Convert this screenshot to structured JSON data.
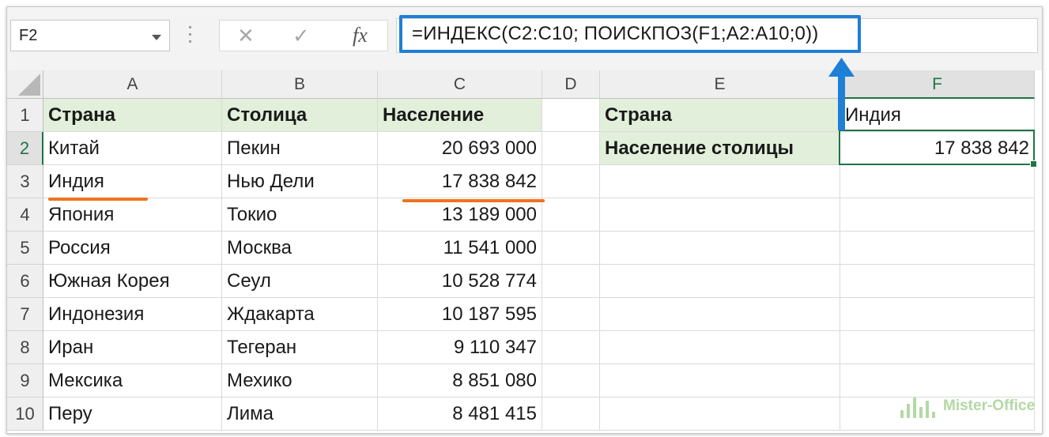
{
  "name_box": {
    "value": "F2"
  },
  "formula_bar": {
    "cancel_glyph": "✕",
    "enter_glyph": "✓",
    "fx_label": "fx",
    "formula": "=ИНДЕКС(C2:C10; ПОИСКПОЗ(F1;A2:A10;0))"
  },
  "columns": [
    "A",
    "B",
    "C",
    "D",
    "E",
    "F"
  ],
  "rows": [
    "1",
    "2",
    "3",
    "4",
    "5",
    "6",
    "7",
    "8",
    "9",
    "10"
  ],
  "table": {
    "headers": [
      "Страна",
      "Столица",
      "Население"
    ],
    "data": [
      [
        "Китай",
        "Пекин",
        "20 693 000"
      ],
      [
        "Индия",
        "Нью Дели",
        "17 838 842"
      ],
      [
        "Япония",
        "Токио",
        "13 189 000"
      ],
      [
        "Россия",
        "Москва",
        "11 541 000"
      ],
      [
        "Южная Корея",
        "Сеул",
        "10 528 774"
      ],
      [
        "Индонезия",
        "Ждакарта",
        "10 187 595"
      ],
      [
        "Иран",
        "Тегеран",
        "9 110 347"
      ],
      [
        "Мексика",
        "Мехико",
        "8 851 080"
      ],
      [
        "Перу",
        "Лима",
        "8 481 415"
      ]
    ]
  },
  "lookup": {
    "e1": "Страна",
    "f1": "Индия",
    "e2": "Население столицы",
    "f2": "17 838 842"
  },
  "selected_cell": "F2",
  "colors": {
    "header_fill": "#e2efda",
    "highlight_frame": "#1e7fd6",
    "underline": "#f07320",
    "selection": "#217346"
  },
  "watermark": {
    "text": "Mister-Office"
  }
}
